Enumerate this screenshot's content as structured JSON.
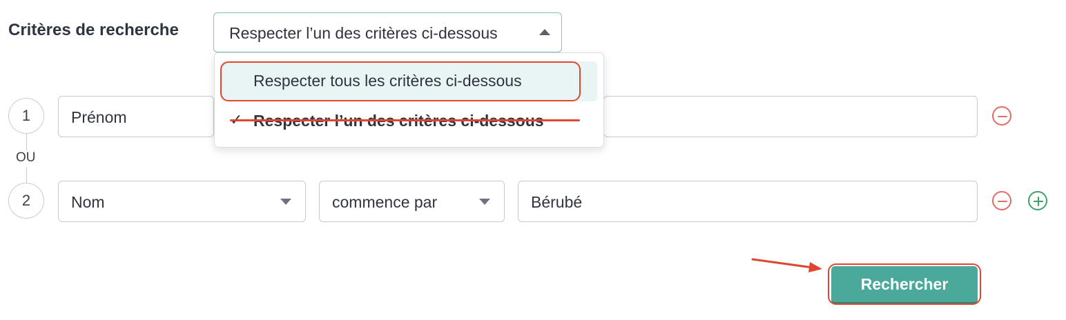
{
  "criteria": {
    "label": "Critères de recherche",
    "selected": "Respecter l’un des critères ci-dessous",
    "options": [
      "Respecter tous les critères ci-dessous",
      "Respecter l’un des critères ci-dessous"
    ],
    "check_glyph": "✓"
  },
  "rows": [
    {
      "number": "1",
      "field": "Prénom"
    },
    {
      "number": "2",
      "field": "Nom",
      "operator": "commence par",
      "value": "Bérubé"
    }
  ],
  "connector_label": "OU",
  "search_button": "Rechercher",
  "colors": {
    "accent": "#4aa99a",
    "annotation": "#e0452f",
    "remove": "#e36a66",
    "add": "#3ea264"
  },
  "icons": {
    "remove": "minus-circle-icon",
    "add": "plus-circle-icon",
    "check": "checkmark-icon",
    "arrow": "arrow-annotation-icon"
  }
}
